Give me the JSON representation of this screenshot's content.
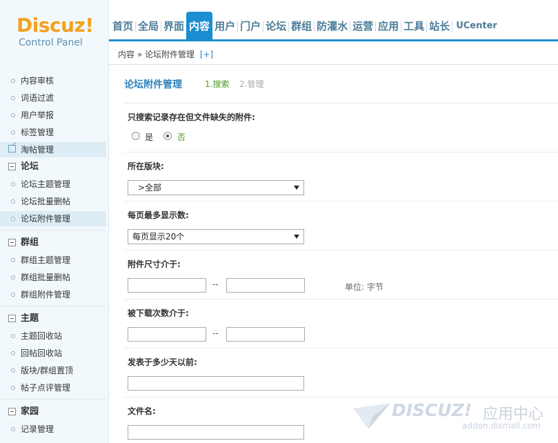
{
  "logo": {
    "main": "Discuz!",
    "sub": "Control Panel"
  },
  "nav": {
    "items": [
      "首页",
      "全局",
      "界面",
      "内容",
      "用户",
      "门户",
      "论坛",
      "群组",
      "防灌水",
      "运营",
      "应用",
      "工具",
      "站长",
      "UCenter"
    ],
    "active_index": 3
  },
  "breadcrumb": {
    "text": "内容 » 论坛附件管理",
    "add": "[+]"
  },
  "sidebar": {
    "items": [
      "内容审核",
      "词语过滤",
      "用户举报",
      "标签管理",
      "淘帖管理"
    ],
    "groups": [
      {
        "title": "论坛",
        "items": [
          "论坛主题管理",
          "论坛批量删帖",
          "论坛附件管理"
        ]
      },
      {
        "title": "群组",
        "items": [
          "群组主题管理",
          "群组批量删帖",
          "群组附件管理"
        ]
      },
      {
        "title": "主题",
        "items": [
          "主题回收站",
          "回帖回收站",
          "版块/群组置顶",
          "帖子点评管理"
        ]
      },
      {
        "title": "家园",
        "items": [
          "记录管理"
        ]
      }
    ]
  },
  "main": {
    "title": "论坛附件管理",
    "steps": [
      "1.搜索",
      "2.管理"
    ],
    "fields": {
      "missing_only": {
        "label": "只搜索记录存在但文件缺失的附件:",
        "options": [
          "是",
          "否"
        ],
        "selected": "否"
      },
      "forum": {
        "label": "所在版块:",
        "value": ">全部"
      },
      "per_page": {
        "label": "每页最多显示数:",
        "value": "每页显示20个"
      },
      "size": {
        "label": "附件尺寸介于:",
        "separator": "--",
        "unit": "单位: 字节"
      },
      "downloads": {
        "label": "被下载次数介于:",
        "separator": "--"
      },
      "days": {
        "label": "发表于多少天以前:"
      },
      "filename": {
        "label": "文件名:"
      }
    }
  },
  "watermark": {
    "brand": "DISCUZ!",
    "cn": "应用中心",
    "url": "addon.dismall.com"
  }
}
